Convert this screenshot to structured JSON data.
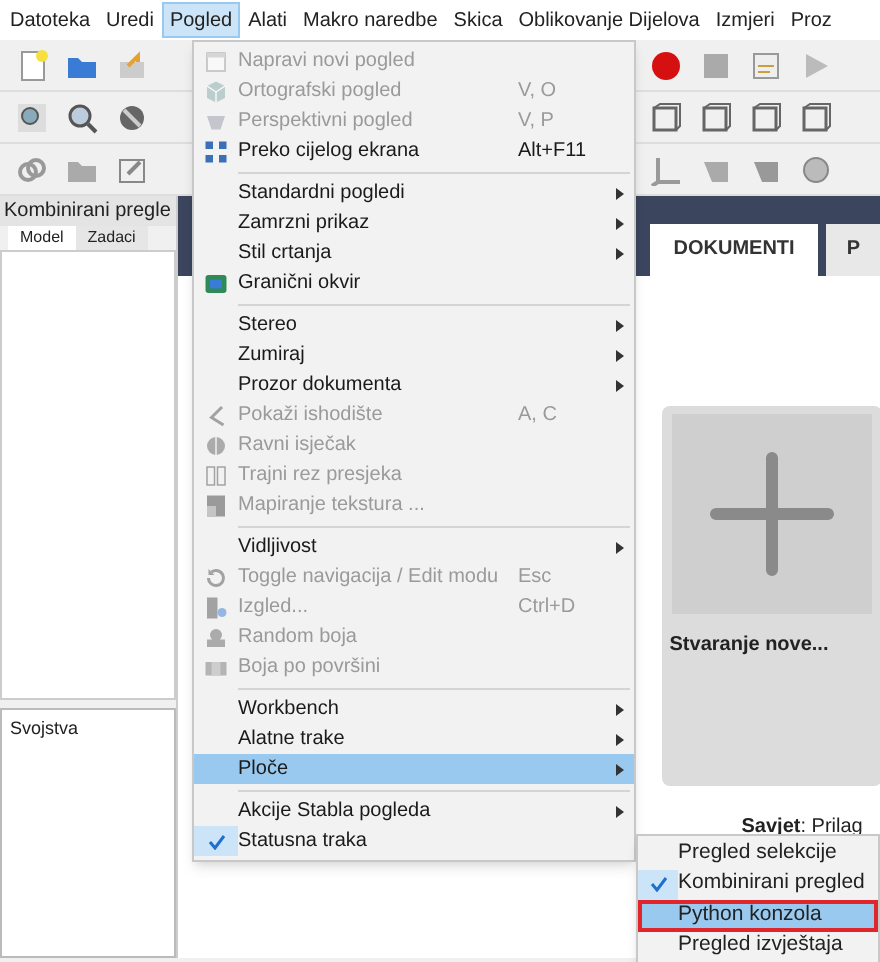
{
  "menubar": [
    {
      "label": "Datoteka",
      "selected": false
    },
    {
      "label": "Uredi",
      "selected": false
    },
    {
      "label": "Pogled",
      "selected": true
    },
    {
      "label": "Alati",
      "selected": false
    },
    {
      "label": "Makro naredbe",
      "selected": false
    },
    {
      "label": "Skica",
      "selected": false
    },
    {
      "label": "Oblikovanje Dijelova",
      "selected": false
    },
    {
      "label": "Izmjeri",
      "selected": false
    },
    {
      "label": "Proz",
      "selected": false
    }
  ],
  "left_panel": {
    "title": "Kombinirani pregle",
    "tabs": [
      {
        "label": "Model",
        "selected": true
      },
      {
        "label": "Zadaci",
        "selected": false
      }
    ],
    "properties_title": "Svojstva"
  },
  "start_page": {
    "tabs": [
      {
        "label": "DOKUMENTI",
        "selected": true
      },
      {
        "label": "P",
        "selected": false
      }
    ],
    "card_label": "Stvaranje nove...",
    "tip": "**Savjet**: Prilag"
  },
  "menu": [
    {
      "kind": "item",
      "label": "Napravi novi pogled",
      "disabled": true,
      "submenu": false,
      "checked": false,
      "selected": false
    },
    {
      "kind": "item",
      "label": "Ortografski pogled",
      "shortcut": "V, O",
      "disabled": true,
      "submenu": false,
      "checked": false,
      "selected": false
    },
    {
      "kind": "item",
      "label": "Perspektivni pogled",
      "shortcut": "V, P",
      "disabled": true,
      "submenu": false,
      "checked": false,
      "selected": false
    },
    {
      "kind": "item",
      "label": "Preko cijelog ekrana",
      "shortcut": "Alt+F11",
      "disabled": false,
      "submenu": false,
      "checked": false,
      "selected": false
    },
    {
      "kind": "separator"
    },
    {
      "kind": "item",
      "label": "Standardni pogledi",
      "disabled": false,
      "submenu": true,
      "checked": false,
      "selected": false
    },
    {
      "kind": "item",
      "label": "Zamrzni prikaz",
      "disabled": false,
      "submenu": true,
      "checked": false,
      "selected": false
    },
    {
      "kind": "item",
      "label": "Stil crtanja",
      "disabled": false,
      "submenu": true,
      "checked": false,
      "selected": false
    },
    {
      "kind": "item",
      "label": "Granični okvir",
      "disabled": false,
      "submenu": false,
      "checked": false,
      "selected": false
    },
    {
      "kind": "separator"
    },
    {
      "kind": "item",
      "label": "Stereo",
      "disabled": false,
      "submenu": true,
      "checked": false,
      "selected": false
    },
    {
      "kind": "item",
      "label": "Zumiraj",
      "disabled": false,
      "submenu": true,
      "checked": false,
      "selected": false
    },
    {
      "kind": "item",
      "label": "Prozor dokumenta",
      "disabled": false,
      "submenu": true,
      "checked": false,
      "selected": false
    },
    {
      "kind": "item",
      "label": "Pokaži ishodište",
      "shortcut": "A, C",
      "disabled": true,
      "submenu": false,
      "checked": false,
      "selected": false
    },
    {
      "kind": "item",
      "label": "Ravni isječak",
      "disabled": true,
      "submenu": false,
      "checked": false,
      "selected": false
    },
    {
      "kind": "item",
      "label": "Trajni rez presjeka",
      "disabled": true,
      "submenu": false,
      "checked": false,
      "selected": false
    },
    {
      "kind": "item",
      "label": "Mapiranje tekstura ...",
      "disabled": true,
      "submenu": false,
      "checked": false,
      "selected": false
    },
    {
      "kind": "separator"
    },
    {
      "kind": "item",
      "label": "Vidljivost",
      "disabled": false,
      "submenu": true,
      "checked": false,
      "selected": false
    },
    {
      "kind": "item",
      "label": "Toggle navigacija / Edit modu",
      "shortcut": "Esc",
      "disabled": true,
      "submenu": false,
      "checked": false,
      "selected": false
    },
    {
      "kind": "item",
      "label": "Izgled...",
      "shortcut": "Ctrl+D",
      "disabled": true,
      "submenu": false,
      "checked": false,
      "selected": false
    },
    {
      "kind": "item",
      "label": "Random boja",
      "disabled": true,
      "submenu": false,
      "checked": false,
      "selected": false
    },
    {
      "kind": "item",
      "label": "Boja po površini",
      "disabled": true,
      "submenu": false,
      "checked": false,
      "selected": false
    },
    {
      "kind": "separator"
    },
    {
      "kind": "item",
      "label": "Workbench",
      "disabled": false,
      "submenu": true,
      "checked": false,
      "selected": false
    },
    {
      "kind": "item",
      "label": "Alatne trake",
      "disabled": false,
      "submenu": true,
      "checked": false,
      "selected": false
    },
    {
      "kind": "item",
      "label": "Ploče",
      "disabled": false,
      "submenu": true,
      "checked": false,
      "selected": true
    },
    {
      "kind": "separator"
    },
    {
      "kind": "item",
      "label": "Akcije Stabla pogleda",
      "disabled": false,
      "submenu": true,
      "checked": false,
      "selected": false
    },
    {
      "kind": "item",
      "label": "Statusna traka",
      "disabled": false,
      "submenu": false,
      "checked": true,
      "selected": false
    }
  ],
  "submenu": [
    {
      "label": "Pregled selekcije",
      "checked": false,
      "selected": false
    },
    {
      "label": "Kombinirani pregled",
      "checked": true,
      "selected": false
    },
    {
      "label": "Python konzola",
      "checked": false,
      "selected": true
    },
    {
      "label": "Pregled izvještaja",
      "checked": false,
      "selected": false
    }
  ]
}
